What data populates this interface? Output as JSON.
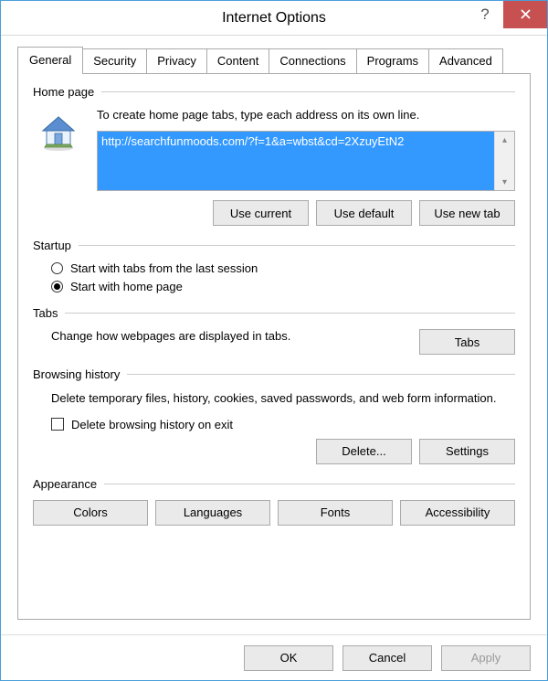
{
  "window": {
    "title": "Internet Options"
  },
  "tabs": [
    "General",
    "Security",
    "Privacy",
    "Content",
    "Connections",
    "Programs",
    "Advanced"
  ],
  "homepage": {
    "title": "Home page",
    "hint": "To create home page tabs, type each address on its own line.",
    "url": "http://searchfunmoods.com/?f=1&a=wbst&cd=2XzuyEtN2",
    "use_current": "Use current",
    "use_default": "Use default",
    "use_new_tab": "Use new tab"
  },
  "startup": {
    "title": "Startup",
    "opt_last": "Start with tabs from the last session",
    "opt_home": "Start with home page"
  },
  "tabs_section": {
    "title": "Tabs",
    "text": "Change how webpages are displayed in tabs.",
    "button": "Tabs"
  },
  "history": {
    "title": "Browsing history",
    "text": "Delete temporary files, history, cookies, saved passwords, and web form information.",
    "checkbox": "Delete browsing history on exit",
    "delete": "Delete...",
    "settings": "Settings"
  },
  "appearance": {
    "title": "Appearance",
    "colors": "Colors",
    "languages": "Languages",
    "fonts": "Fonts",
    "accessibility": "Accessibility"
  },
  "footer": {
    "ok": "OK",
    "cancel": "Cancel",
    "apply": "Apply"
  }
}
